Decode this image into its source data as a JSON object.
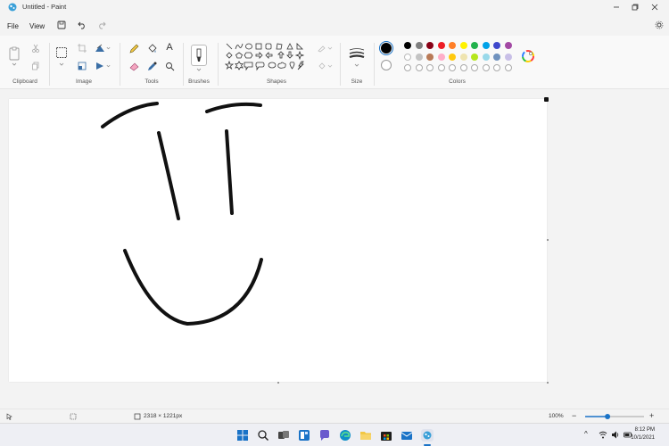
{
  "window": {
    "title": "Untitled - Paint"
  },
  "menu": {
    "file": "File",
    "view": "View"
  },
  "ribbon": {
    "groups": {
      "clipboard": "Clipboard",
      "image": "Image",
      "tools": "Tools",
      "brushes": "Brushes",
      "shapes": "Shapes",
      "size": "Size",
      "colors": "Colors"
    },
    "tools_text_glyph": "A",
    "palette_row1": [
      "#000000",
      "#7f7f7f",
      "#880015",
      "#ed1c24",
      "#ff7f27",
      "#fff200",
      "#22b14c",
      "#00a2e8",
      "#3f48cc",
      "#a349a4"
    ],
    "palette_row2": [
      "#ffffff",
      "#c3c3c3",
      "#b97a57",
      "#ffaec9",
      "#ffc90e",
      "#efe4b0",
      "#b5e61d",
      "#99d9ea",
      "#7092be",
      "#c8bfe7"
    ],
    "primary_color": "#000000",
    "secondary_color": "#ffffff"
  },
  "status": {
    "canvas_size": "2318 × 1221px",
    "zoom": "100%",
    "zoom_minus": "−",
    "zoom_plus": "+",
    "zoom_fraction": 0.38
  },
  "taskbar": {
    "time": "8:12 PM",
    "date": "10/1/2021",
    "chevron": "^"
  }
}
